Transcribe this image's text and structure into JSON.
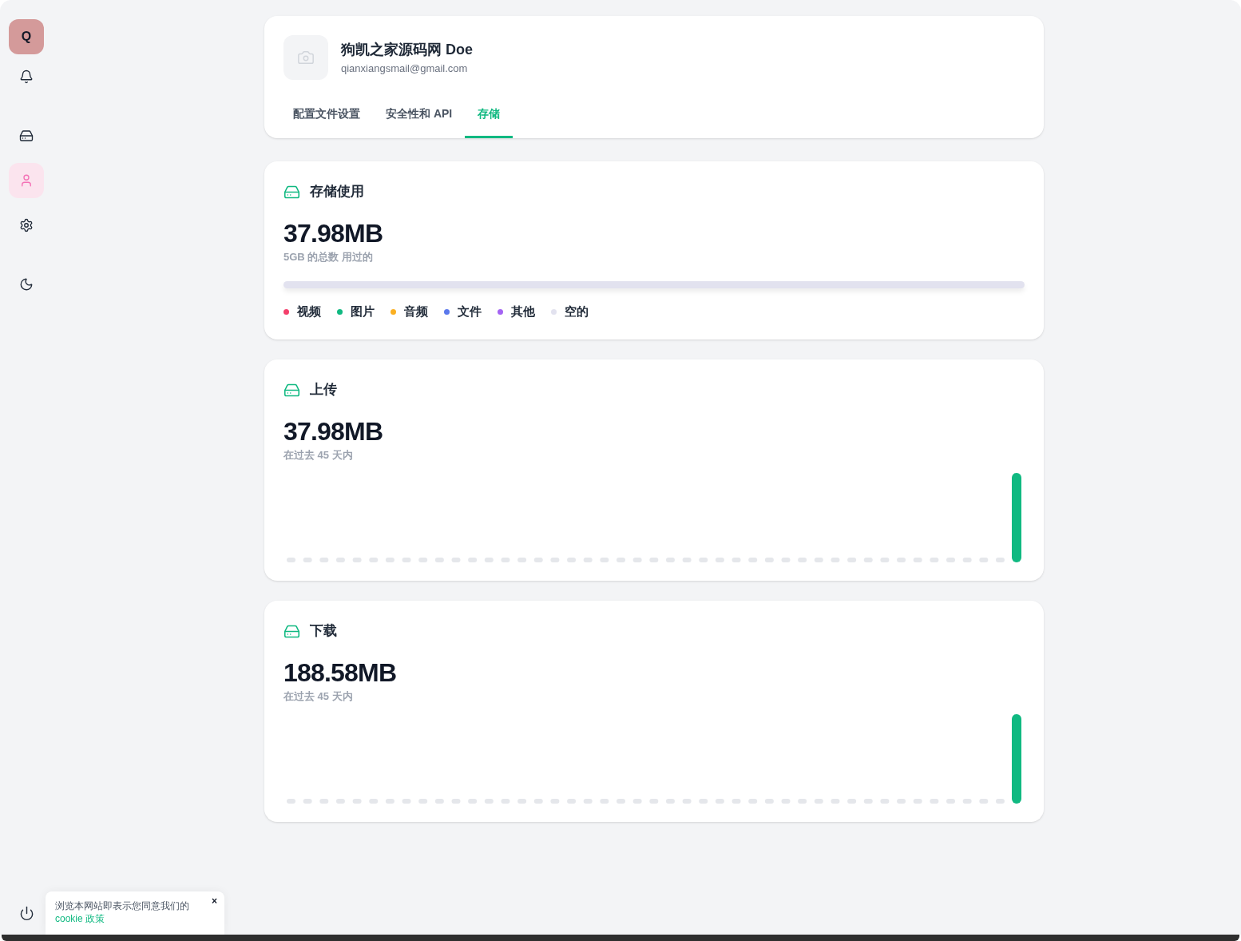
{
  "sidebar": {
    "avatar": "Q",
    "groups": [
      {
        "items": [
          {
            "kind": "notifications",
            "selected": false
          }
        ]
      },
      {
        "items": [
          {
            "kind": "storage",
            "selected": false
          },
          {
            "kind": "profile",
            "selected": true
          },
          {
            "kind": "settings",
            "selected": false
          }
        ]
      },
      {
        "items": [
          {
            "kind": "theme",
            "selected": false
          }
        ]
      }
    ]
  },
  "profile": {
    "name": "狗凯之家源码网 Doe",
    "email": "qianxiangsmail@gmail.com"
  },
  "tabs": [
    {
      "label": "配置文件设置",
      "selected": false
    },
    {
      "label": "安全性和 API",
      "selected": false
    },
    {
      "label": "存储",
      "selected": true
    }
  ],
  "cards": [
    {
      "kind": "usage",
      "title": "存储使用",
      "value": "37.98MB",
      "caption": "5GB 的总数 用过的",
      "legend": [
        {
          "label": "视频",
          "color": "#f43f6b"
        },
        {
          "label": "图片",
          "color": "#10b981"
        },
        {
          "label": "音频",
          "color": "#fbb022"
        },
        {
          "label": "文件",
          "color": "#5a78ec"
        },
        {
          "label": "其他",
          "color": "#a464f3"
        },
        {
          "label": "空的",
          "color": "#e2e2ef"
        }
      ]
    },
    {
      "kind": "activity",
      "title": "上传",
      "value": "37.98MB",
      "caption": "在过去 45 天内"
    },
    {
      "kind": "activity",
      "title": "下载",
      "value": "188.58MB",
      "caption": "在过去 45 天内"
    }
  ],
  "cookie_banner": {
    "text": "浏览本网站即表示您同意我们的",
    "link": "cookie 政策",
    "close": "×"
  }
}
